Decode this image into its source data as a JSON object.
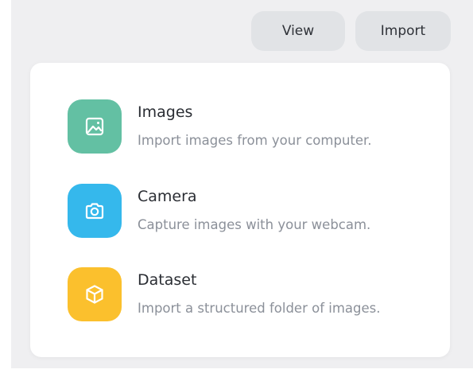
{
  "toolbar": {
    "view_label": "View",
    "import_label": "Import"
  },
  "import_menu": {
    "options": [
      {
        "title": "Images",
        "description": "Import images from your computer.",
        "icon": "image-icon",
        "color": "#63c0a3"
      },
      {
        "title": "Camera",
        "description": "Capture images with your webcam.",
        "icon": "camera-icon",
        "color": "#35b8ec"
      },
      {
        "title": "Dataset",
        "description": "Import a structured folder of images.",
        "icon": "cube-icon",
        "color": "#fbc02d"
      }
    ]
  }
}
